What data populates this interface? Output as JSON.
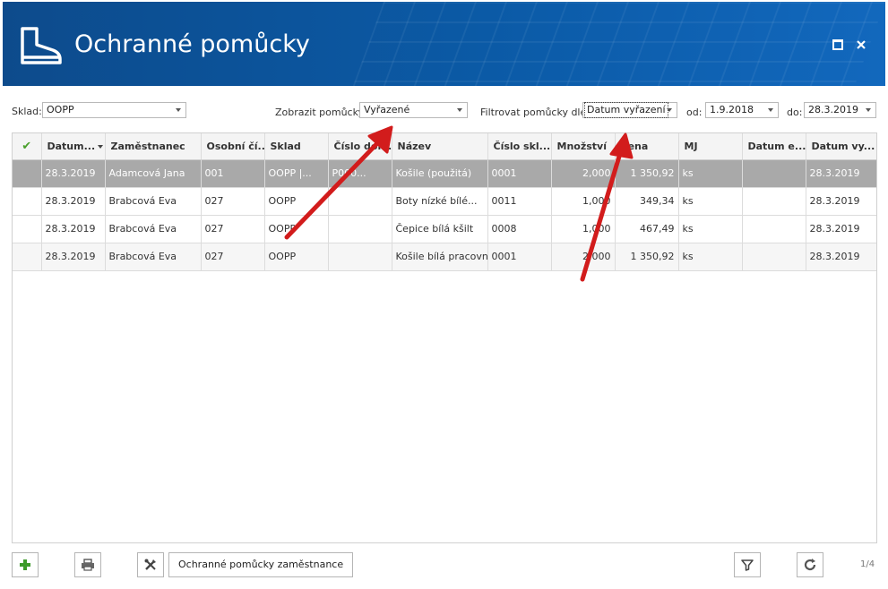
{
  "header": {
    "title": "Ochranné pomůcky",
    "icon": "boot-icon",
    "accent": "#0b5aa6"
  },
  "filters": {
    "sklad_label": "Sklad:",
    "sklad_value": "OOPP",
    "zobrazit_label": "Zobrazit pomůcky:",
    "zobrazit_value": "Vyřazené",
    "filtrovat_label": "Filtrovat pomůcky dle:",
    "filtrovat_value": "Datum vyřazení",
    "od_label": "od:",
    "od_value": "1.9.2018",
    "do_label": "do:",
    "do_value": "28.3.2019"
  },
  "grid": {
    "columns": [
      "✔",
      "Datum...",
      "Zaměstnanec",
      "Osobní čí...",
      "Sklad",
      "Číslo dok...",
      "Název",
      "Číslo skl...",
      "Množství",
      "Cena",
      "MJ",
      "Datum e...",
      "Datum vy..."
    ],
    "rows": [
      [
        "",
        "28.3.2019",
        "Adamcová Jana",
        "001",
        "OOPP |...",
        "P000...",
        "Košile (použitá)",
        "0001",
        "2,000",
        "1 350,92",
        "ks",
        "",
        "28.3.2019"
      ],
      [
        "",
        "28.3.2019",
        "Brabcová Eva",
        "027",
        "OOPP",
        "",
        "Boty nízké bílé...",
        "0011",
        "1,000",
        "349,34",
        "ks",
        "",
        "28.3.2019"
      ],
      [
        "",
        "28.3.2019",
        "Brabcová Eva",
        "027",
        "OOPP",
        "",
        "Čepice bílá kšilt",
        "0008",
        "1,000",
        "467,49",
        "ks",
        "",
        "28.3.2019"
      ],
      [
        "",
        "28.3.2019",
        "Brabcová Eva",
        "027",
        "OOPP",
        "",
        "Košile bílá pracovní",
        "0001",
        "2,000",
        "1 350,92",
        "ks",
        "",
        "28.3.2019"
      ]
    ]
  },
  "toolbar": {
    "employee_button": "Ochranné pomůcky zaměstnance",
    "pager": "1/4"
  },
  "colors": {
    "annotation_arrow": "#d21c1c",
    "selected_row": "#a9a9a9"
  }
}
